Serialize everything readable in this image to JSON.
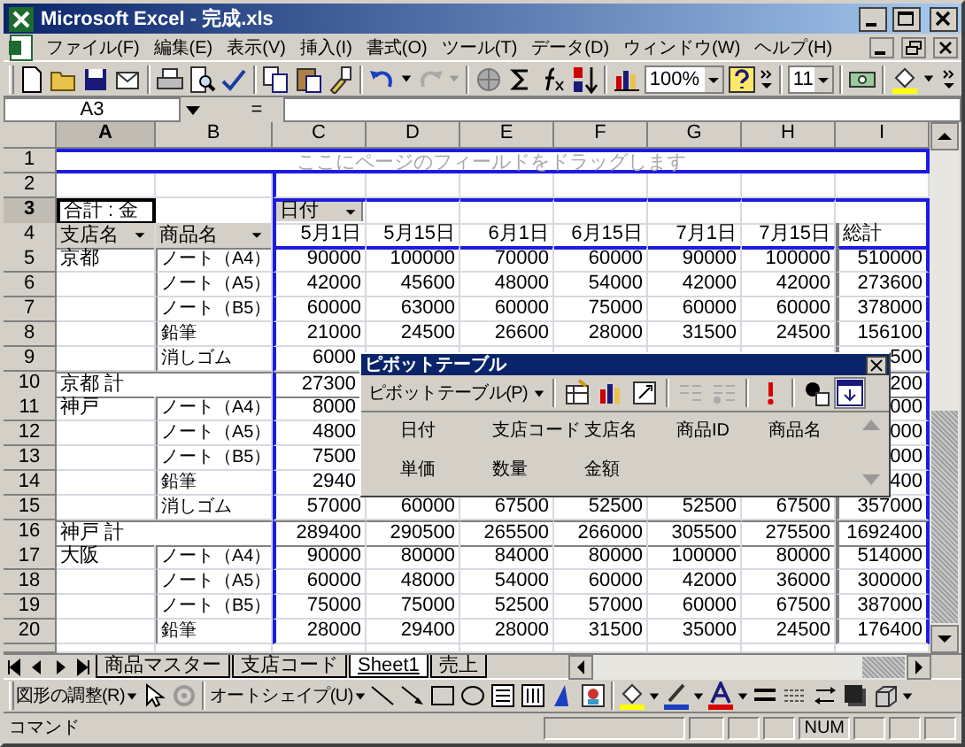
{
  "window": {
    "title": "Microsoft Excel - 完成.xls"
  },
  "menu": [
    "ファイル(F)",
    "編集(E)",
    "表示(V)",
    "挿入(I)",
    "書式(O)",
    "ツール(T)",
    "データ(D)",
    "ウィンドウ(W)",
    "ヘルプ(H)"
  ],
  "toolbar": {
    "zoom": "100%",
    "font_size": "11"
  },
  "formula_bar": {
    "name_box": "A3",
    "equals": "="
  },
  "columns": [
    {
      "label": "A",
      "selected": true
    },
    {
      "label": "B",
      "selected": false
    },
    {
      "label": "C",
      "selected": false
    },
    {
      "label": "D",
      "selected": false
    },
    {
      "label": "E",
      "selected": false
    },
    {
      "label": "F",
      "selected": false
    },
    {
      "label": "G",
      "selected": false
    },
    {
      "label": "H",
      "selected": false
    },
    {
      "label": "I",
      "selected": false
    }
  ],
  "row_numbers": [
    {
      "label": "1",
      "selected": false
    },
    {
      "label": "2",
      "selected": false
    },
    {
      "label": "3",
      "selected": true
    },
    {
      "label": "4",
      "selected": false
    },
    {
      "label": "5",
      "selected": false
    },
    {
      "label": "6",
      "selected": false
    },
    {
      "label": "7",
      "selected": false
    },
    {
      "label": "8",
      "selected": false
    },
    {
      "label": "9",
      "selected": false
    },
    {
      "label": "10",
      "selected": false
    },
    {
      "label": "11",
      "selected": false
    },
    {
      "label": "12",
      "selected": false
    },
    {
      "label": "13",
      "selected": false
    },
    {
      "label": "14",
      "selected": false
    },
    {
      "label": "15",
      "selected": false
    },
    {
      "label": "16",
      "selected": false
    },
    {
      "label": "17",
      "selected": false
    },
    {
      "label": "18",
      "selected": false
    },
    {
      "label": "19",
      "selected": false
    },
    {
      "label": "20",
      "selected": false
    }
  ],
  "page_area": {
    "hint": "ここにページのフィールドをドラッグします"
  },
  "pivot": {
    "data_field": "合計 : 金",
    "column_field": "日付",
    "row_fields": [
      "支店名",
      "商品名"
    ],
    "dates": [
      "5月1日",
      "5月15日",
      "6月1日",
      "6月15日",
      "7月1日",
      "7月15日"
    ],
    "total_heading": "総計"
  },
  "data_rows": [
    {
      "kind": "item",
      "branch": "京都",
      "product": "ノート（A4）",
      "values": [
        "90000",
        "100000",
        "70000",
        "60000",
        "90000",
        "100000"
      ],
      "total": "510000"
    },
    {
      "kind": "item",
      "product": "ノート（A5）",
      "values": [
        "42000",
        "45600",
        "48000",
        "54000",
        "42000",
        "42000"
      ],
      "total": "273600"
    },
    {
      "kind": "item",
      "product": "ノート（B5）",
      "values": [
        "60000",
        "63000",
        "60000",
        "75000",
        "60000",
        "60000"
      ],
      "total": "378000"
    },
    {
      "kind": "item",
      "product": "鉛筆",
      "values": [
        "21000",
        "24500",
        "26600",
        "28000",
        "31500",
        "24500"
      ],
      "total": "156100"
    },
    {
      "kind": "item",
      "product": "消しゴム",
      "values": [
        "6000"
      ],
      "total": "500"
    },
    {
      "kind": "subtotal",
      "branch": "京都 計",
      "values": [
        "27300"
      ],
      "total": "200"
    },
    {
      "kind": "item",
      "branch": "神戸",
      "product": "ノート（A4）",
      "values": [
        "8000"
      ],
      "total": "000"
    },
    {
      "kind": "item",
      "product": "ノート（A5）",
      "values": [
        "4800"
      ],
      "total": "000"
    },
    {
      "kind": "item",
      "product": "ノート（B5）",
      "values": [
        "7500"
      ],
      "total": "000"
    },
    {
      "kind": "item",
      "product": "鉛筆",
      "values": [
        "2940"
      ],
      "total": "400"
    },
    {
      "kind": "item",
      "product": "消しゴム",
      "values": [
        "57000",
        "60000",
        "67500",
        "52500",
        "52500",
        "67500"
      ],
      "total": "357000"
    },
    {
      "kind": "subtotal",
      "branch": "神戸 計",
      "values": [
        "289400",
        "290500",
        "265500",
        "266000",
        "305500",
        "275500"
      ],
      "total": "1692400"
    },
    {
      "kind": "item",
      "branch": "大阪",
      "product": "ノート（A4）",
      "values": [
        "90000",
        "80000",
        "84000",
        "80000",
        "100000",
        "80000"
      ],
      "total": "514000"
    },
    {
      "kind": "item",
      "product": "ノート（A5）",
      "values": [
        "60000",
        "48000",
        "54000",
        "60000",
        "42000",
        "36000"
      ],
      "total": "300000"
    },
    {
      "kind": "item",
      "product": "ノート（B5）",
      "values": [
        "75000",
        "75000",
        "52500",
        "57000",
        "60000",
        "67500"
      ],
      "total": "387000"
    },
    {
      "kind": "item",
      "product": "鉛筆",
      "values": [
        "28000",
        "29400",
        "28000",
        "31500",
        "35000",
        "24500"
      ],
      "total": "176400"
    }
  ],
  "pivot_toolbar": {
    "title": "ピボットテーブル",
    "menu": "ピボットテーブル(P)",
    "fields": [
      "日付",
      "支店コード",
      "支店名",
      "商品ID",
      "商品名",
      "単価",
      "数量",
      "金額"
    ]
  },
  "sheet_tabs": [
    {
      "label": "商品マスター",
      "selected": false
    },
    {
      "label": "支店コード",
      "selected": false
    },
    {
      "label": "Sheet1",
      "selected": true
    },
    {
      "label": "売上",
      "selected": false
    }
  ],
  "drawing_toolbar": {
    "adjust": "図形の調整(R)",
    "autoshape": "オートシェイプ(U)"
  },
  "status_bar": {
    "mode": "コマンド",
    "num": "NUM"
  }
}
